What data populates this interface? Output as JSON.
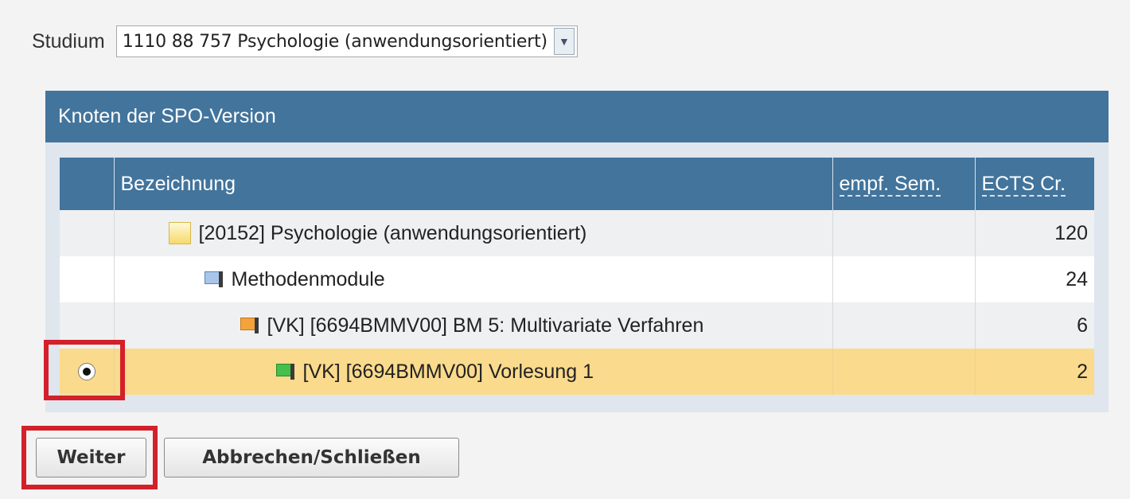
{
  "studium": {
    "label": "Studium",
    "selected": "1110 88 757 Psychologie (anwendungsorientiert)",
    "arrow_icon": "chevron-down-icon"
  },
  "panel": {
    "title": "Knoten der SPO-Version"
  },
  "table": {
    "columns": [
      "",
      "Bezeichnung",
      "empf. Sem.",
      "ECTS Cr."
    ],
    "rows": [
      {
        "icon": "folder-icon",
        "label": "[20152] Psychologie (anwendungsorientiert)",
        "sem": "",
        "ects": "120",
        "selected": false
      },
      {
        "icon": "module-icon",
        "label": "Methodenmodule",
        "sem": "",
        "ects": "24",
        "selected": false
      },
      {
        "icon": "module-orange-icon",
        "label": "[VK] [6694BMMV00] BM 5: Multivariate Verfahren",
        "sem": "",
        "ects": "6",
        "selected": false
      },
      {
        "icon": "module-green-icon",
        "label": "[VK] [6694BMMV00] Vorlesung 1",
        "sem": "",
        "ects": "2",
        "selected": true
      }
    ]
  },
  "buttons": {
    "next": "Weiter",
    "cancel": "Abbrechen/Schließen"
  },
  "colors": {
    "header_blue": "#42749c",
    "selected_row": "#fada8c",
    "highlight_red": "#d3202a"
  }
}
